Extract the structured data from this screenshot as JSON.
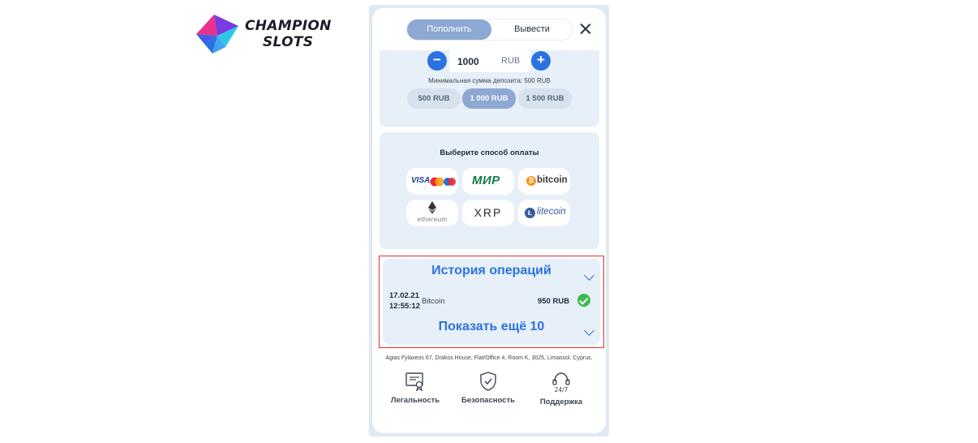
{
  "brand": {
    "line1": "CHAMPION",
    "line2": "SLOTS",
    "colors": {
      "magenta": "#e8328c",
      "cyan": "#2ec7e6",
      "blue": "#3f5fe8",
      "purple": "#7a3be0"
    }
  },
  "tabs": [
    {
      "label": "Пополнить",
      "active": true
    },
    {
      "label": "Вывести",
      "active": false
    }
  ],
  "close_icon": "close-icon",
  "deposit": {
    "amount": "1000",
    "currency": "RUB",
    "minus_symbol": "−",
    "plus_symbol": "+",
    "min_note": "Минимальная сумма депозита: 500 RUB",
    "presets": [
      {
        "label": "500 RUB",
        "selected": false
      },
      {
        "label": "1 000 RUB",
        "selected": true
      },
      {
        "label": "1 500 RUB",
        "selected": false
      }
    ]
  },
  "payment": {
    "title": "Выберите способ оплаты",
    "methods": {
      "visa": "VISA",
      "mir": "МИР",
      "bitcoin": "bitcoin",
      "ethereum": "ethereum",
      "xrp": "XRP",
      "litecoin": "litecoin"
    }
  },
  "history": {
    "title": "История операций",
    "rows": [
      {
        "date": "17.02.21",
        "time": "12:55:12",
        "method": "Bitcoin",
        "amount": "950 RUB",
        "status": "success"
      }
    ],
    "show_more": "Показать ещё 10"
  },
  "footer": {
    "address": "Agias Fylaxeos 67, Drakos House, Flat/Office 4, Room K, 3025, Limassol, Cyprus.",
    "support_badge": "24/7",
    "items": [
      {
        "label": "Легальность",
        "icon": "certificate-icon"
      },
      {
        "label": "Безопасность",
        "icon": "shield-check-icon"
      },
      {
        "label": "Поддержка",
        "icon": "headset-icon"
      }
    ]
  },
  "colors": {
    "accent": "#2b72e0",
    "tab_active": "#8da8d2",
    "card_bg": "#e7eff8",
    "highlight": "#e0322e",
    "success": "#3dbb4e"
  }
}
